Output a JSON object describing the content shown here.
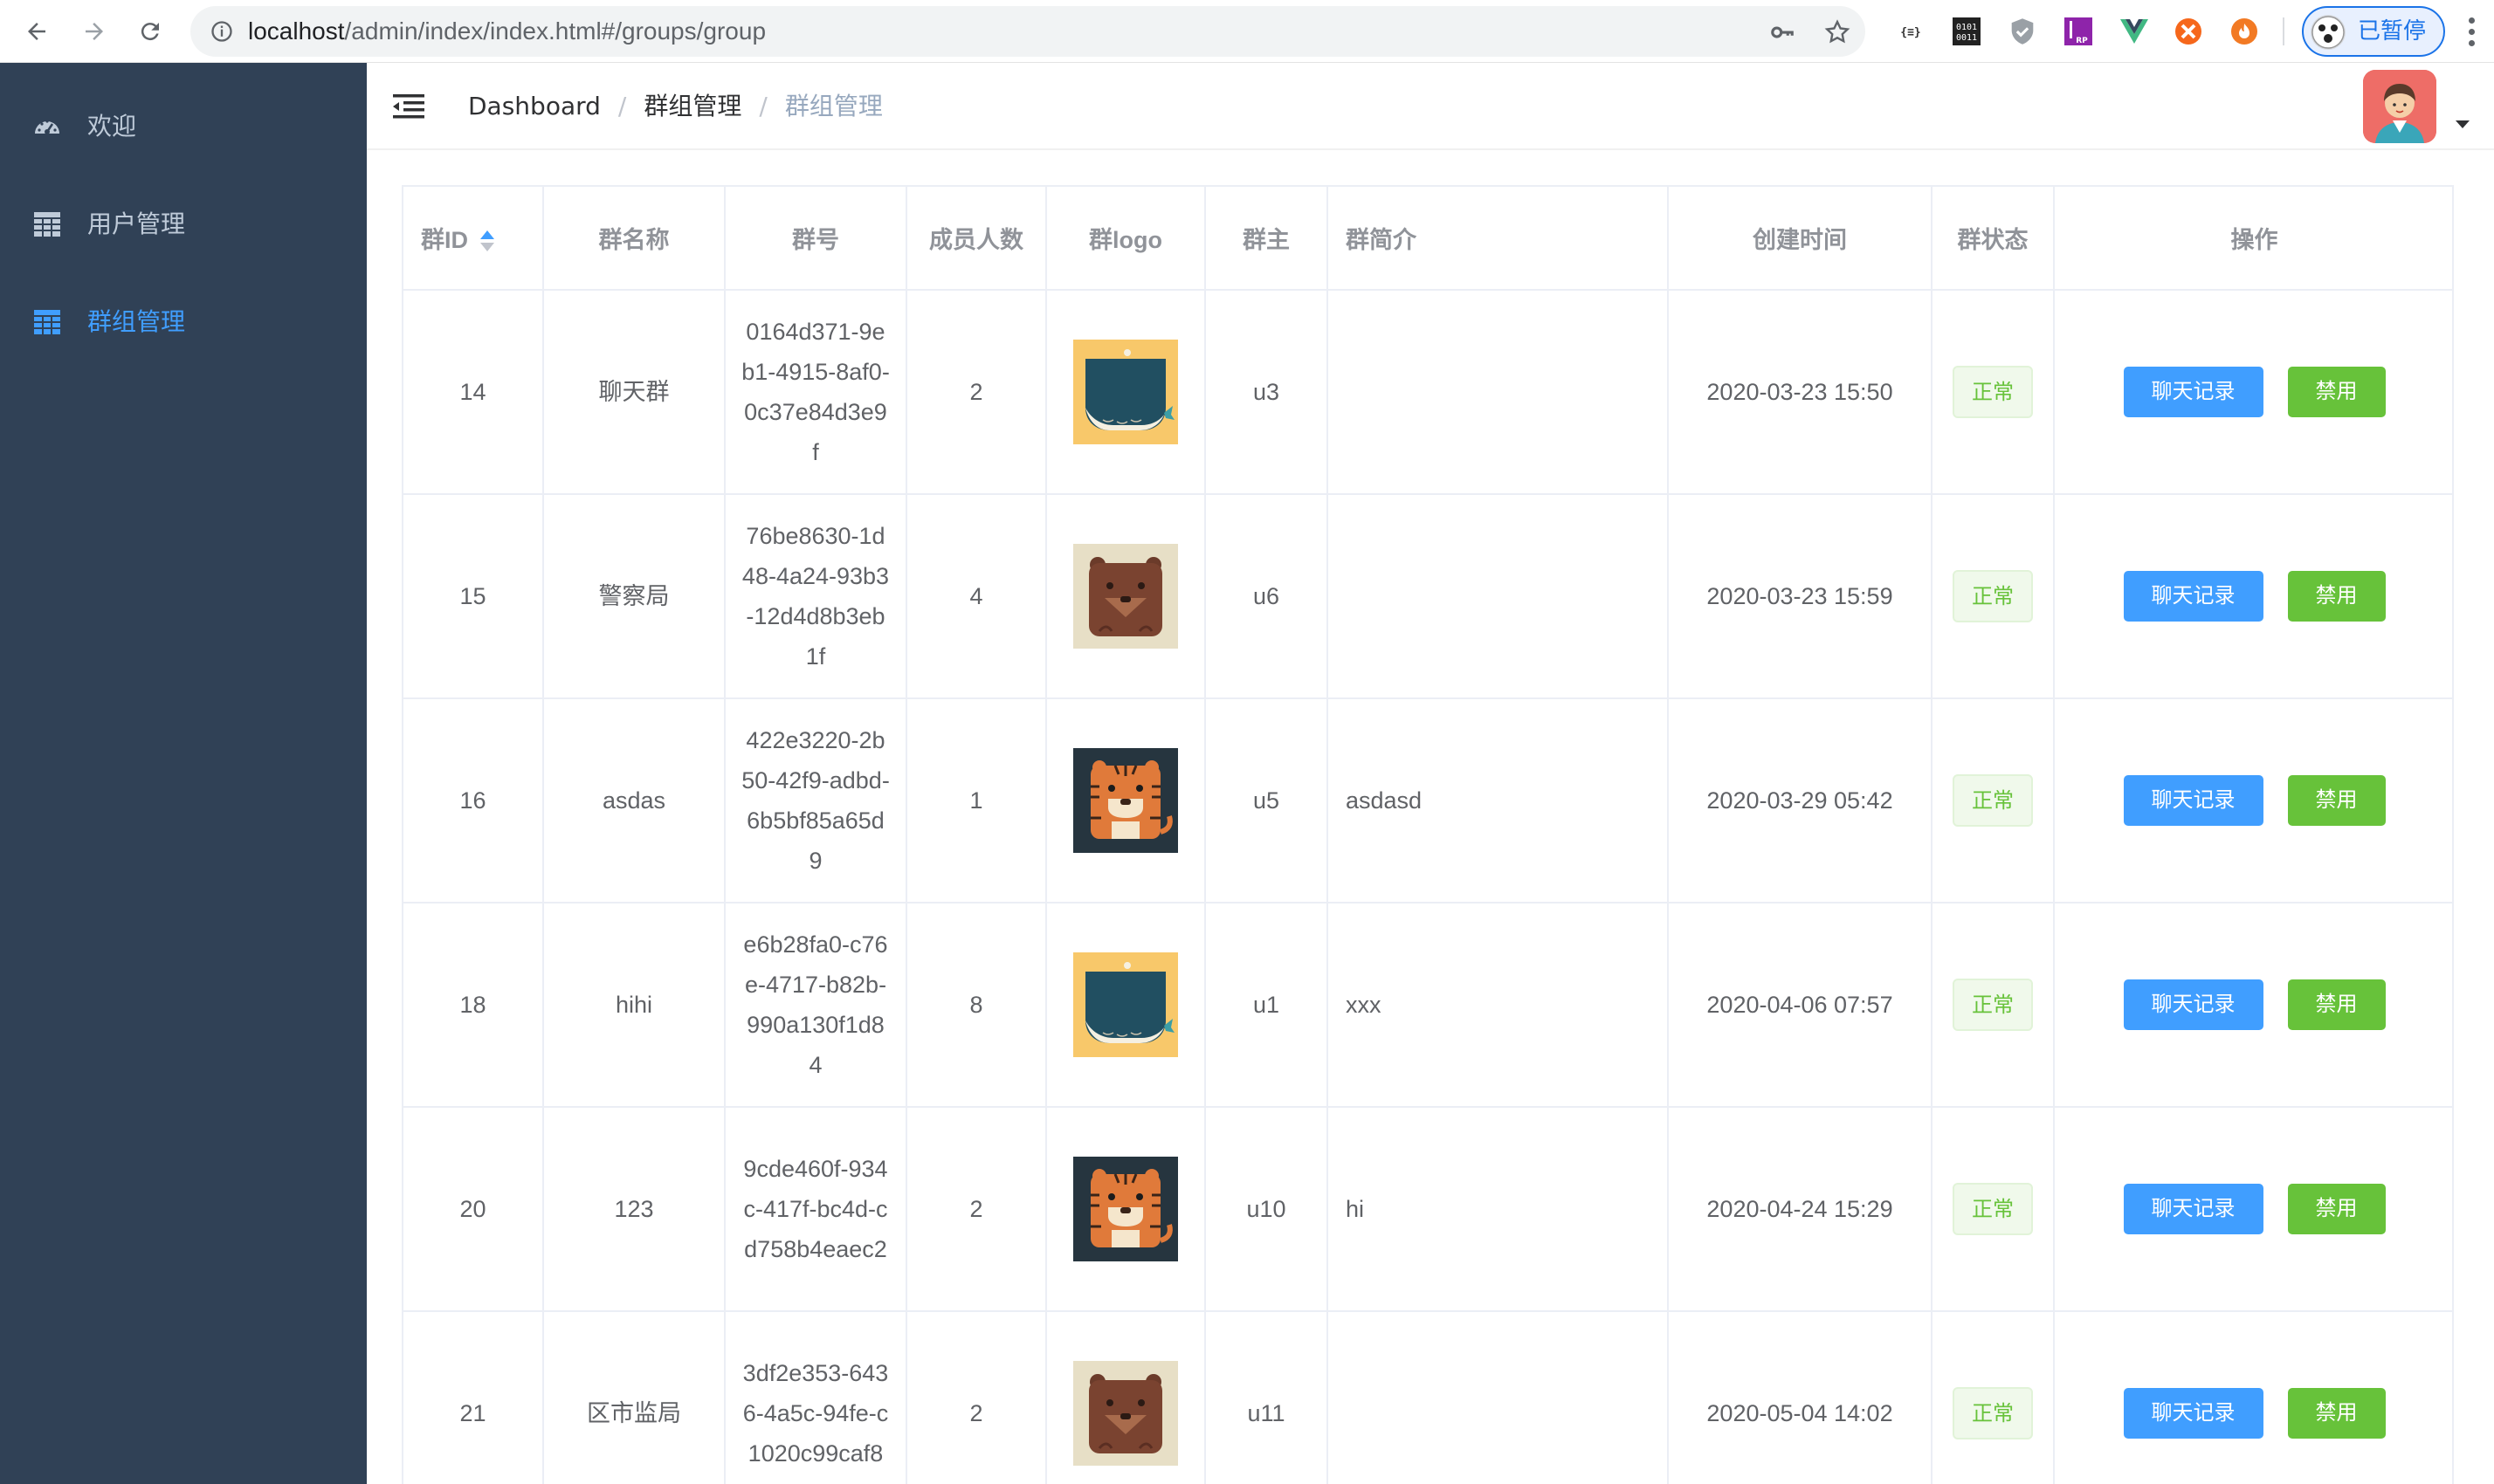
{
  "browser": {
    "url_host": "localhost",
    "url_path": "/admin/index/index.html#/groups/group",
    "profile_label": "已暂停"
  },
  "sidebar": {
    "items": [
      {
        "label": "欢迎",
        "icon": "dashboard-icon",
        "active": false
      },
      {
        "label": "用户管理",
        "icon": "table-icon",
        "active": false
      },
      {
        "label": "群组管理",
        "icon": "table-icon",
        "active": true
      }
    ]
  },
  "breadcrumb": {
    "items": [
      "Dashboard",
      "群组管理",
      "群组管理"
    ],
    "separator": "/"
  },
  "table": {
    "columns": [
      "群ID",
      "群名称",
      "群号",
      "成员人数",
      "群logo",
      "群主",
      "群简介",
      "创建时间",
      "群状态",
      "操作"
    ],
    "rows": [
      {
        "id": "14",
        "name": "聊天群",
        "number": "0164d371-9eb1-4915-8af0-0c37e84d3e9f",
        "members": "2",
        "logo": "whale-logo",
        "owner": "u3",
        "intro": "",
        "created": "2020-03-23 15:50",
        "status": "正常",
        "action_chat": "聊天记录",
        "action_ban": "禁用"
      },
      {
        "id": "15",
        "name": "警察局",
        "number": "76be8630-1d48-4a24-93b3-12d4d8b3eb1f",
        "members": "4",
        "logo": "bear-logo",
        "owner": "u6",
        "intro": "",
        "created": "2020-03-23 15:59",
        "status": "正常",
        "action_chat": "聊天记录",
        "action_ban": "禁用"
      },
      {
        "id": "16",
        "name": "asdas",
        "number": "422e3220-2b50-42f9-adbd-6b5bf85a65d9",
        "members": "1",
        "logo": "tiger-logo",
        "owner": "u5",
        "intro": "asdasd",
        "created": "2020-03-29 05:42",
        "status": "正常",
        "action_chat": "聊天记录",
        "action_ban": "禁用"
      },
      {
        "id": "18",
        "name": "hihi",
        "number": "e6b28fa0-c76e-4717-b82b-990a130f1d84",
        "members": "8",
        "logo": "whale-logo",
        "owner": "u1",
        "intro": "xxx",
        "created": "2020-04-06 07:57",
        "status": "正常",
        "action_chat": "聊天记录",
        "action_ban": "禁用"
      },
      {
        "id": "20",
        "name": "123",
        "number": "9cde460f-934c-417f-bc4d-cd758b4eaec2",
        "members": "2",
        "logo": "tiger-logo",
        "owner": "u10",
        "intro": "hi",
        "created": "2020-04-24 15:29",
        "status": "正常",
        "action_chat": "聊天记录",
        "action_ban": "禁用"
      },
      {
        "id": "21",
        "name": "区市监局",
        "number": "3df2e353-6436-4a5c-94fe-c1020c99caf8",
        "members": "2",
        "logo": "bear-logo",
        "owner": "u11",
        "intro": "",
        "created": "2020-05-04 14:02",
        "status": "正常",
        "action_chat": "聊天记录",
        "action_ban": "禁用"
      }
    ]
  },
  "colors": {
    "sidebar_bg": "#304156",
    "sidebar_text": "#bfcbd9",
    "primary": "#409eff",
    "success": "#67c23a"
  }
}
